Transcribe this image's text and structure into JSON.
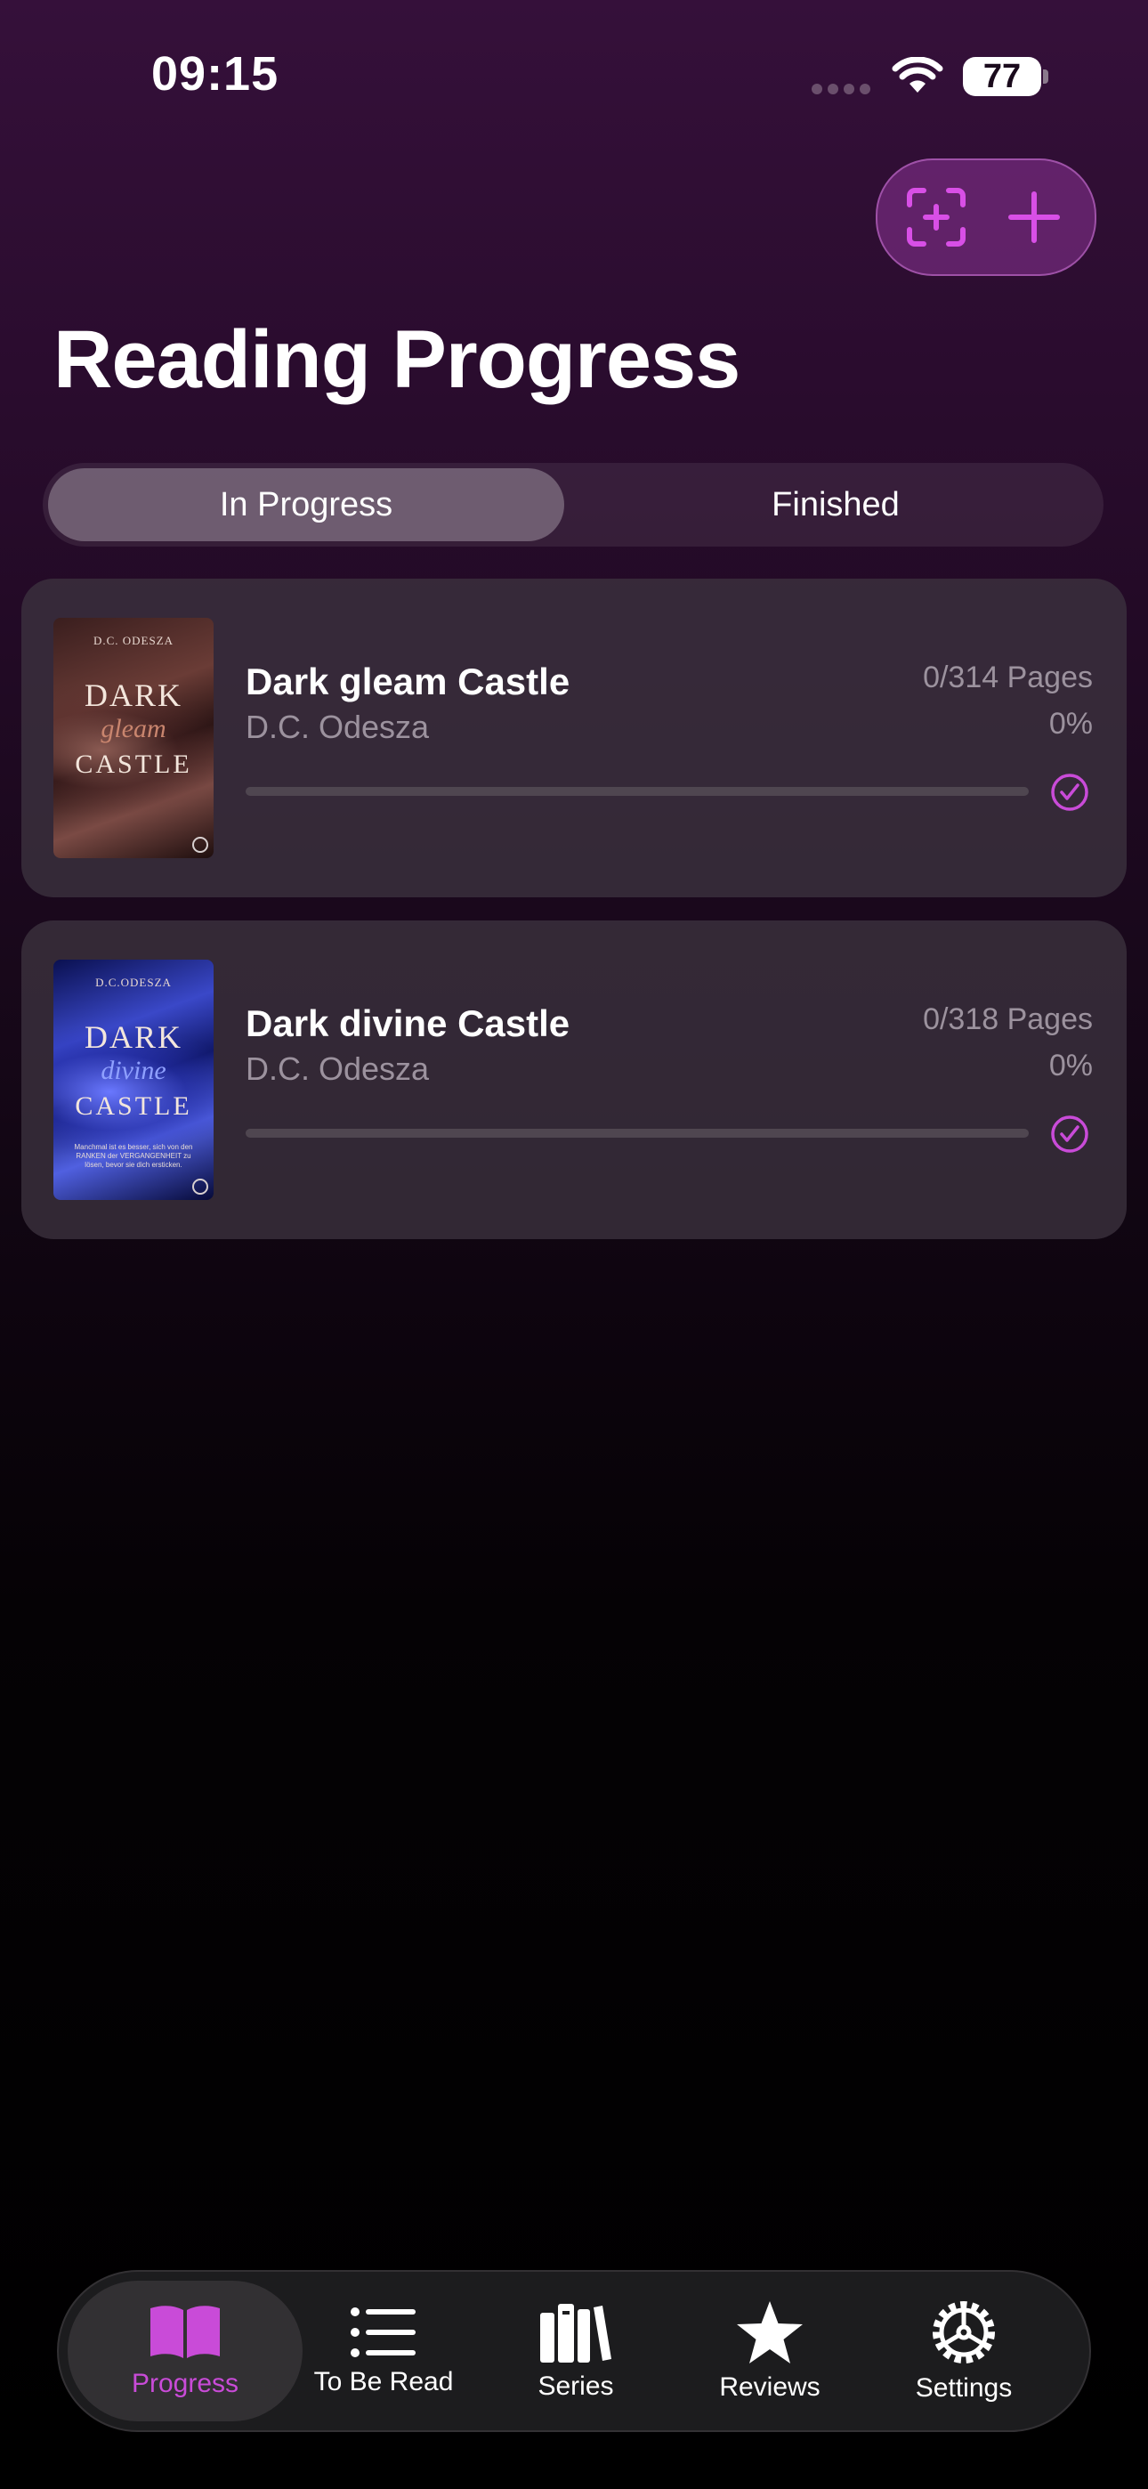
{
  "status_bar": {
    "time": "09:15",
    "battery": "77"
  },
  "page_title": "Reading Progress",
  "segments": [
    {
      "label": "In Progress",
      "selected": true
    },
    {
      "label": "Finished",
      "selected": false
    }
  ],
  "books": [
    {
      "title": "Dark gleam Castle",
      "author": "D.C. Odesza",
      "pages": "0/314 Pages",
      "percent": "0%",
      "progress": 0,
      "cover": {
        "author": "D.C. ODESZA",
        "title_1": "DARK",
        "title_2": "gleam",
        "title_3": "CASTLE",
        "colors": {
          "base": "#2a1414",
          "wave": "#7a4a44",
          "accent": "#c9856e"
        }
      }
    },
    {
      "title": "Dark divine Castle",
      "author": "D.C. Odesza",
      "pages": "0/318 Pages",
      "percent": "0%",
      "progress": 0,
      "cover": {
        "author": "D.C.ODESZA",
        "title_1": "DARK",
        "title_2": "divine",
        "title_3": "CASTLE",
        "blurb": "Manchmal ist es besser, sich von den RANKEN der VERGANGENHEIT zu lösen, bevor sie dich ersticken.",
        "colors": {
          "base": "#0a1050",
          "wave": "#3a48c8",
          "accent": "#8fa0ff"
        }
      }
    }
  ],
  "tabs": [
    {
      "label": "Progress",
      "icon": "book-open-icon",
      "active": true
    },
    {
      "label": "To Be Read",
      "icon": "list-icon",
      "active": false
    },
    {
      "label": "Series",
      "icon": "books-icon",
      "active": false
    },
    {
      "label": "Reviews",
      "icon": "star-icon",
      "active": false
    },
    {
      "label": "Settings",
      "icon": "gear-icon",
      "active": false
    }
  ],
  "colors": {
    "accent": "#c94bd8",
    "card": "#3e3440",
    "secondary_text": "#9c929e"
  }
}
